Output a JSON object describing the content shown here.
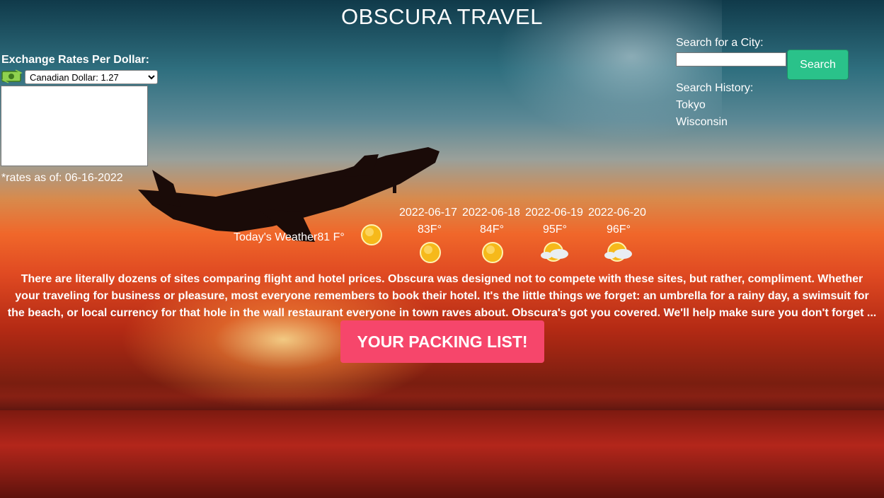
{
  "app": {
    "title": "OBSCURA TRAVEL"
  },
  "exchange": {
    "label": "Exchange Rates Per Dollar:",
    "icon": "money-exchange-icon",
    "selected_option": "Canadian Dollar: 1.27",
    "rates_date": "*rates as of: 06-16-2022"
  },
  "search": {
    "label": "Search for a City:",
    "input_value": "",
    "button_label": "Search",
    "history_label": "Search History:",
    "history": [
      "Tokyo",
      "Wisconsin"
    ]
  },
  "weather": {
    "today_label": "Today's Weather",
    "today_temp": "81 F°",
    "today_icon": "sun-icon",
    "forecast": [
      {
        "date": "2022-06-17",
        "temp": "83F°",
        "icon": "sun-icon"
      },
      {
        "date": "2022-06-18",
        "temp": "84F°",
        "icon": "sun-icon"
      },
      {
        "date": "2022-06-19",
        "temp": "95F°",
        "icon": "partly-cloudy-icon"
      },
      {
        "date": "2022-06-20",
        "temp": "96F°",
        "icon": "partly-cloudy-icon"
      }
    ]
  },
  "about": {
    "lines": [
      "There are literally dozens of sites comparing flight and hotel prices. Obscura was designed not to compete with these sites, but rather, compliment. Whether",
      "your traveling for business or pleasure, most everyone remembers to book their hotel. It's the little things we forget: an umbrella for a rainy day, a swimsuit for",
      "the beach, or local currency for that hole in the wall restaurant everyone in town raves about. Obscura's got you covered. We'll help make sure you don't forget ..."
    ]
  },
  "packing": {
    "button_label": "YOUR PACKING LIST!"
  },
  "colors": {
    "search_button": "#2ac28a",
    "packing_button": "#f6466b",
    "text": "#ffffff"
  }
}
